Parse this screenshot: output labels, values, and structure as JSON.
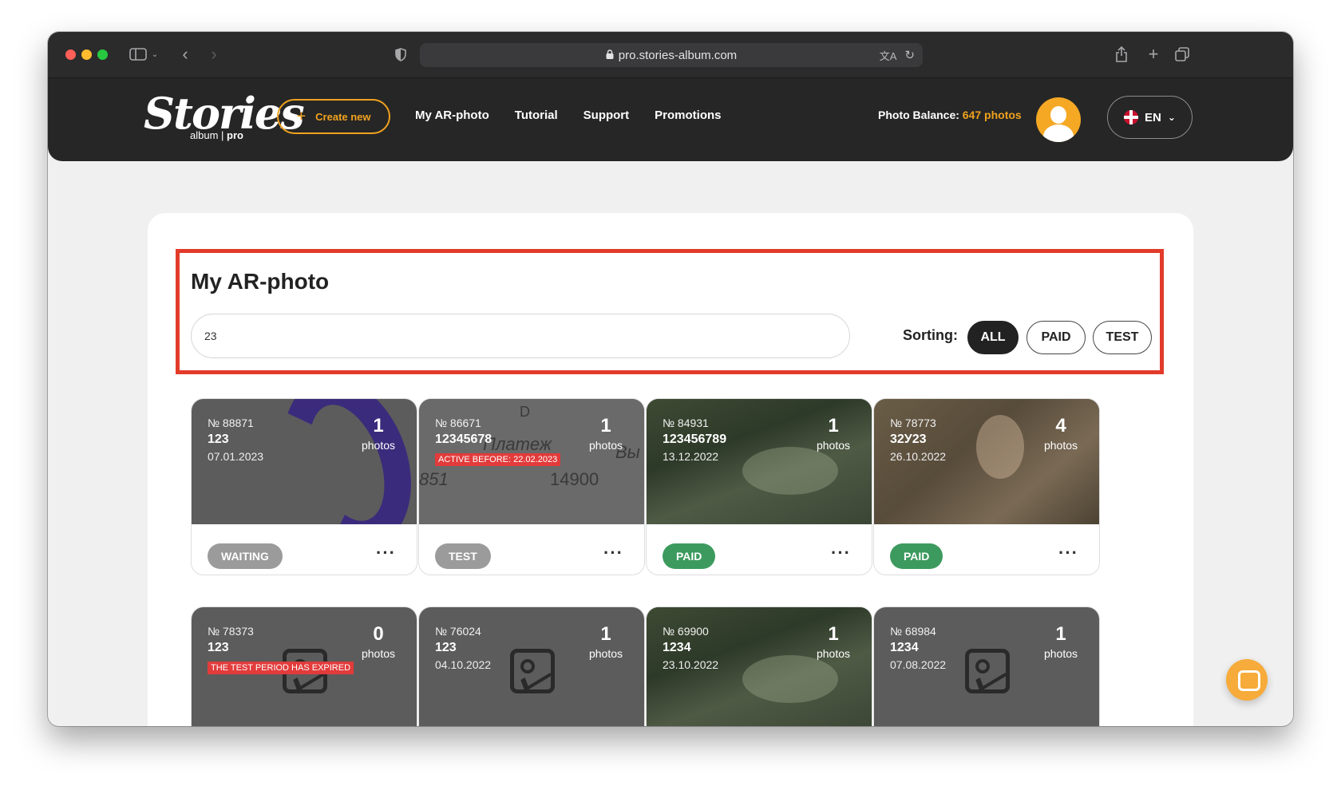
{
  "browser": {
    "url": "pro.stories-album.com"
  },
  "header": {
    "logo_script": "Stories",
    "logo_sub_album": "album",
    "logo_sub_pro": "pro",
    "create_label": "Create new",
    "nav": [
      "My AR-photo",
      "Tutorial",
      "Support",
      "Promotions"
    ],
    "balance_label": "Photo Balance:",
    "balance_value": "647 photos",
    "lang": "EN"
  },
  "main": {
    "title": "My AR-photo",
    "search_value": "23",
    "sorting_label": "Sorting:",
    "filters": [
      "ALL",
      "PAID",
      "TEST"
    ],
    "active_filter": "ALL"
  },
  "cards": [
    {
      "number": "№ 88871",
      "name": "123",
      "date": "07.01.2023",
      "count": "1",
      "unit": "photos",
      "status": "WAITING",
      "warning": ""
    },
    {
      "number": "№ 86671",
      "name": "12345678",
      "date": "",
      "count": "1",
      "unit": "photos",
      "status": "TEST",
      "warning": "ACTIVE BEFORE: 22.02.2023"
    },
    {
      "number": "№ 84931",
      "name": "123456789",
      "date": "13.12.2022",
      "count": "1",
      "unit": "photos",
      "status": "PAID",
      "warning": ""
    },
    {
      "number": "№ 78773",
      "name": "32У23",
      "date": "26.10.2022",
      "count": "4",
      "unit": "photos",
      "status": "PAID",
      "warning": ""
    },
    {
      "number": "№ 78373",
      "name": "123",
      "date": "",
      "count": "0",
      "unit": "photos",
      "status": "",
      "warning": "THE TEST PERIOD HAS EXPIRED"
    },
    {
      "number": "№ 76024",
      "name": "123",
      "date": "04.10.2022",
      "count": "1",
      "unit": "photos",
      "status": "",
      "warning": ""
    },
    {
      "number": "№ 69900",
      "name": "1234",
      "date": "23.10.2022",
      "count": "1",
      "unit": "photos",
      "status": "",
      "warning": ""
    },
    {
      "number": "№ 68984",
      "name": "1234",
      "date": "07.08.2022",
      "count": "1",
      "unit": "photos",
      "status": "",
      "warning": ""
    }
  ],
  "sheet_text": {
    "top": "D",
    "row1": "Платеж",
    "row1b": "Вы",
    "row2a": "851",
    "row2b": "14900"
  },
  "menu_glyph": "···",
  "colors": {
    "accent": "#f0a21e",
    "highlight": "#e23b2a",
    "paid": "#3d9a5e",
    "neutral_badge": "#9b9b9b",
    "header_bg": "#262626"
  }
}
